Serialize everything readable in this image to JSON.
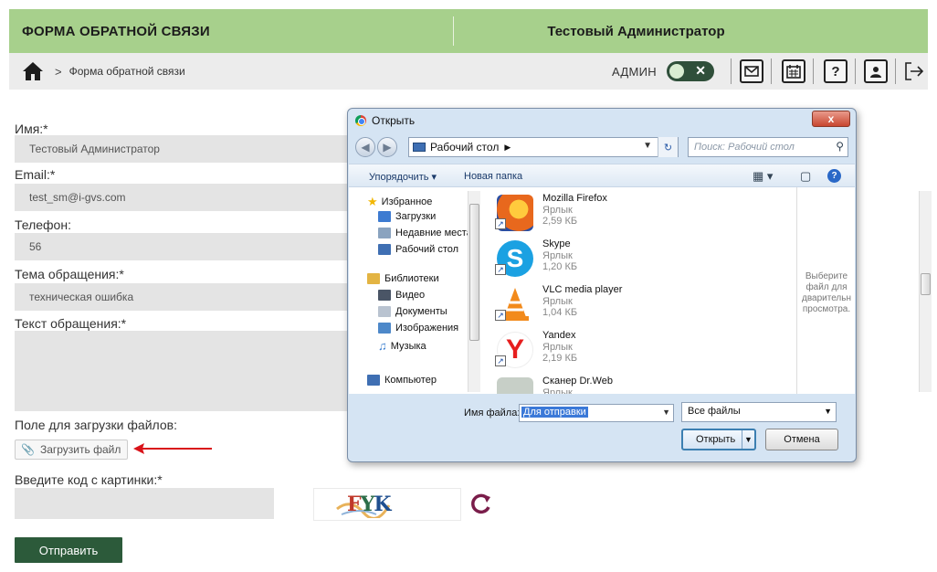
{
  "header": {
    "form_title": "ФОРМА ОБРАТНОЙ СВЯЗИ",
    "user_name": "Тестовый Администратор"
  },
  "breadcrumb": {
    "current": "Форма обратной связи",
    "separator": ">"
  },
  "admin": {
    "label": "АДМИН",
    "toggle_symbol": "✕"
  },
  "toolbar": {
    "help_symbol": "?"
  },
  "form": {
    "name_label": "Имя:*",
    "name_value": "Тестовый Администратор",
    "email_label": "Email:*",
    "email_value": "test_sm@i-gvs.com",
    "phone_label": "Телефон:",
    "phone_value": "56",
    "subject_label": "Тема обращения:*",
    "subject_value": "техническая ошибка",
    "message_label": "Текст обращения:*",
    "upload_label": "Поле для загрузки файлов:",
    "upload_button": "Загрузить файл",
    "captcha_label": "Введите код с картинки:*",
    "captcha_text": "FYK",
    "submit_button": "Отправить"
  },
  "dialog": {
    "title": "Открыть",
    "close_symbol": "x",
    "location": "Рабочий стол",
    "search_placeholder": "Поиск: Рабочий стол",
    "organize": "Упорядочить ▾",
    "new_folder": "Новая папка",
    "tree": [
      {
        "label": "Избранное",
        "color": "#f2b705"
      },
      {
        "label": "Загрузки",
        "color": "#3d7bd1"
      },
      {
        "label": "Недавние места",
        "color": "#8aa3bf"
      },
      {
        "label": "Рабочий стол",
        "color": "#3f6fb3"
      },
      {
        "label": "Библиотеки",
        "color": "#e3b443"
      },
      {
        "label": "Видео",
        "color": "#4a5566"
      },
      {
        "label": "Документы",
        "color": "#b9c3d0"
      },
      {
        "label": "Изображения",
        "color": "#4d88c9"
      },
      {
        "label": "Музыка",
        "color": "#3b7fd0"
      },
      {
        "label": "Компьютер",
        "color": "#3f6fb3"
      }
    ],
    "files": [
      {
        "name": "Mozilla Firefox",
        "type": "Ярлык",
        "size": "2,59 КБ",
        "color": "#e8681d"
      },
      {
        "name": "Skype",
        "type": "Ярлык",
        "size": "1,20 КБ",
        "color": "#1ba1e2"
      },
      {
        "name": "VLC media player",
        "type": "Ярлык",
        "size": "1,04 КБ",
        "color": "#f28a1b"
      },
      {
        "name": "Yandex",
        "type": "Ярлык",
        "size": "2,19 КБ",
        "color": "#e61e1e"
      },
      {
        "name": "Сканер Dr.Web",
        "type": "Ярлык",
        "size": "",
        "color": "#7b8a7b"
      }
    ],
    "preview_text": "Выберите файл для дварительн просмотра.",
    "filename_label": "Имя файла:",
    "filename_value": "Для отправки",
    "file_type": "Все файлы",
    "open_button": "Открыть",
    "cancel_button": "Отмена"
  },
  "colors": {
    "header_green": "#a7d08c",
    "submit_green": "#2c5a3a",
    "arrow_red": "#d9131a"
  }
}
